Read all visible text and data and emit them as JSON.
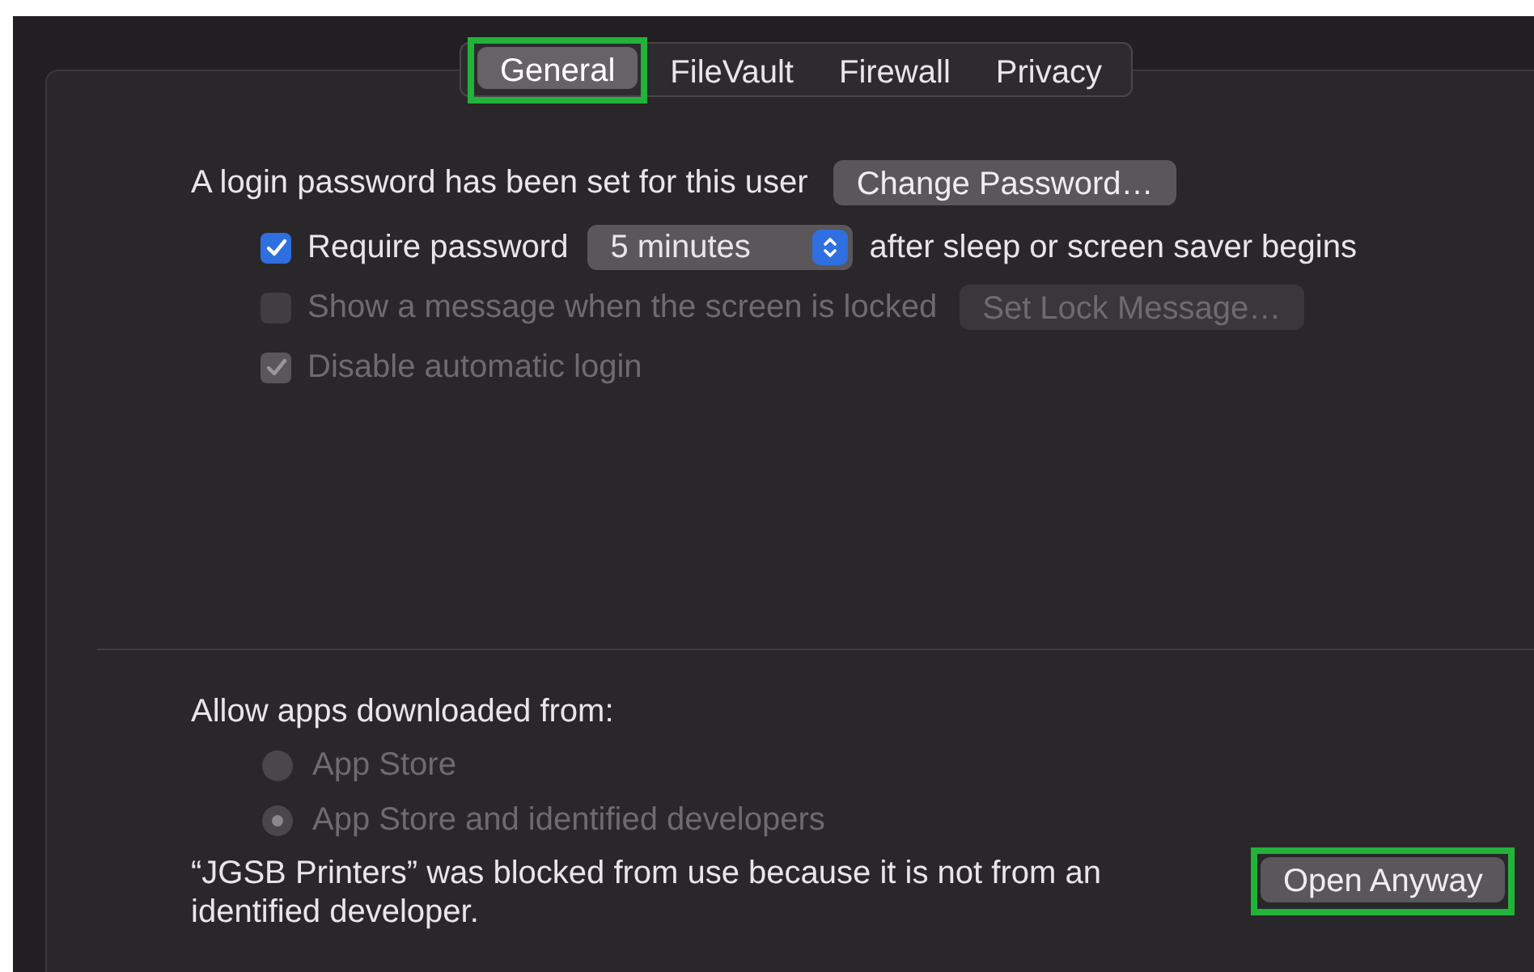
{
  "tabs": [
    {
      "label": "General",
      "selected": true,
      "highlighted": true
    },
    {
      "label": "FileVault",
      "selected": false,
      "highlighted": false
    },
    {
      "label": "Firewall",
      "selected": false,
      "highlighted": false
    },
    {
      "label": "Privacy",
      "selected": false,
      "highlighted": false
    }
  ],
  "login_password": {
    "text": "A login password has been set for this user",
    "button": "Change Password…"
  },
  "checkboxes": [
    {
      "label": "Require password",
      "checked": true,
      "disabled": false,
      "popup": "5 minutes",
      "suffix": "after sleep or screen saver begins"
    },
    {
      "label": "Show a message when the screen is locked",
      "checked": false,
      "disabled": true,
      "button": "Set Lock Message…"
    },
    {
      "label": "Disable automatic login",
      "checked": true,
      "disabled": true
    }
  ],
  "allow_apps": {
    "label": "Allow apps downloaded from:",
    "options": [
      {
        "label": "App Store",
        "selected": false,
        "disabled": true
      },
      {
        "label": "App Store and identified developers",
        "selected": true,
        "disabled": true
      }
    ]
  },
  "blocked": {
    "message": "“JGSB Printers” was blocked from use because it is not from an identified developer.",
    "button": {
      "label": "Open Anyway",
      "highlighted": true
    }
  }
}
